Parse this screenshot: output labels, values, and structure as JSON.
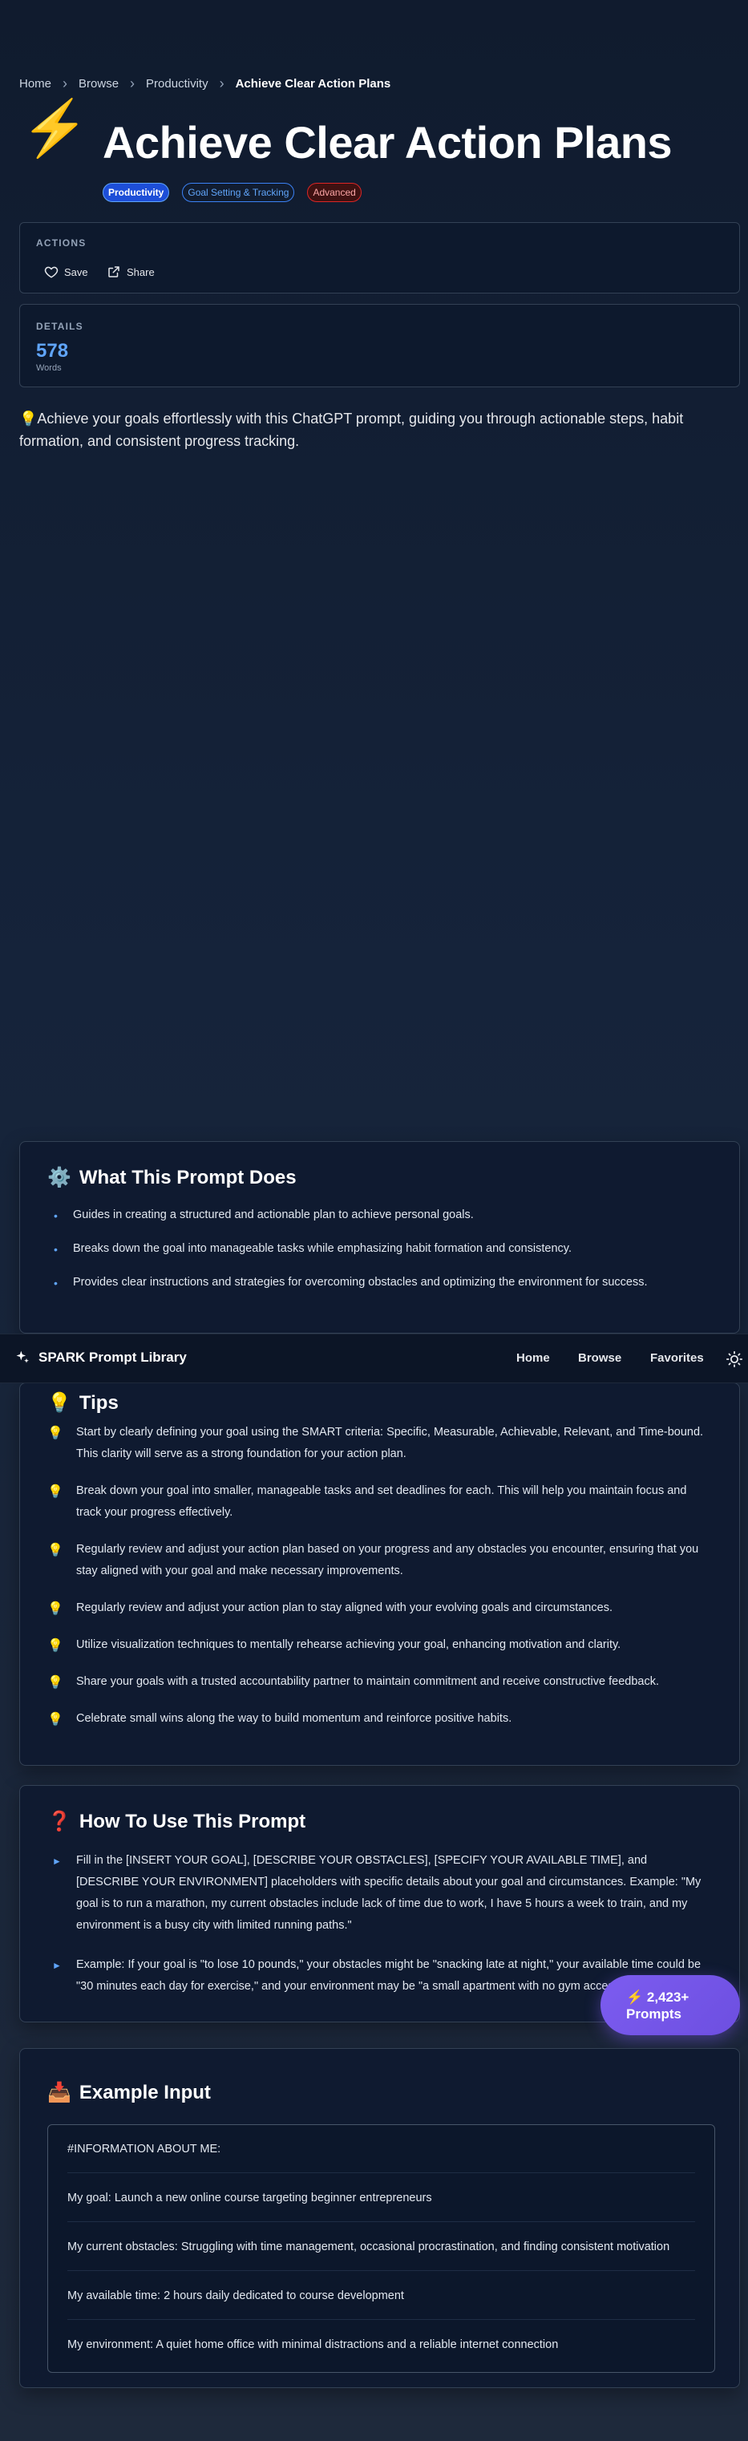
{
  "breadcrumb": {
    "items": [
      "Home",
      "Browse",
      "Productivity"
    ],
    "current": "Achieve Clear Action Plans"
  },
  "hero": {
    "icon": "⚡",
    "title": "Achieve Clear Action Plans",
    "tags": [
      "Productivity",
      "Goal Setting & Tracking",
      "Advanced"
    ]
  },
  "actions": {
    "label": "ACTIONS",
    "save_label": "Save",
    "share_label": "Share"
  },
  "details": {
    "label": "DETAILS",
    "words_count": "578",
    "words_label": "Words"
  },
  "intro": "💡Achieve your goals effortlessly with this ChatGPT prompt, guiding you through actionable steps, habit formation, and consistent progress tracking.",
  "what_prompt_does": {
    "icon": "⚙️",
    "title": "What This Prompt Does",
    "items": [
      "Guides in creating a structured and actionable plan to achieve personal goals.",
      "Breaks down the goal into manageable tasks while emphasizing habit formation and consistency.",
      "Provides clear instructions and strategies for overcoming obstacles and optimizing the environment for success."
    ]
  },
  "navbar": {
    "brand": "SPARK Prompt Library",
    "links": [
      "Home",
      "Browse",
      "Favorites"
    ]
  },
  "tips": {
    "icon": "💡",
    "title": "Tips",
    "items": [
      "Start by clearly defining your goal using the SMART criteria: Specific, Measurable, Achievable, Relevant, and Time-bound. This clarity will serve as a strong foundation for your action plan.",
      "Break down your goal into smaller, manageable tasks and set deadlines for each. This will help you maintain focus and track your progress effectively.",
      "Regularly review and adjust your action plan based on your progress and any obstacles you encounter, ensuring that you stay aligned with your goal and make necessary improvements.",
      "Regularly review and adjust your action plan to stay aligned with your evolving goals and circumstances.",
      "Utilize visualization techniques to mentally rehearse achieving your goal, enhancing motivation and clarity.",
      "Share your goals with a trusted accountability partner to maintain commitment and receive constructive feedback.",
      "Celebrate small wins along the way to build momentum and reinforce positive habits."
    ]
  },
  "how_to_use": {
    "icon": "❓",
    "title": "How To Use This Prompt",
    "items": [
      "Fill in the [INSERT YOUR GOAL], [DESCRIBE YOUR OBSTACLES], [SPECIFY YOUR AVAILABLE TIME], and [DESCRIBE YOUR ENVIRONMENT] placeholders with specific details about your goal and circumstances. Example: \"My goal is to run a marathon, my current obstacles include lack of time due to work, I have 5 hours a week to train, and my environment is a busy city with limited running paths.\"",
      "Example: If your goal is \"to lose 10 pounds,\" your obstacles might be \"snacking late at night,\" your available time could be \"30 minutes each day for exercise,\" and your environment may be \"a small apartment with no gym access.\""
    ]
  },
  "fab": {
    "line1": "⚡ 2,423+",
    "line2": "Prompts"
  },
  "example_input": {
    "icon": "📥",
    "title": "Example Input",
    "lines": [
      "#INFORMATION ABOUT ME:",
      "My goal: Launch a new online course targeting beginner entrepreneurs",
      "My current obstacles: Struggling with time management, occasional procrastination, and finding consistent motivation",
      "My available time: 2 hours daily dedicated to course development",
      "My environment: A quiet home office with minimal distractions and a reliable internet connection"
    ]
  },
  "colors": {
    "accent": "#60a5fa",
    "fab": "#7c5cf0",
    "tag_advanced": "#dc2626"
  }
}
